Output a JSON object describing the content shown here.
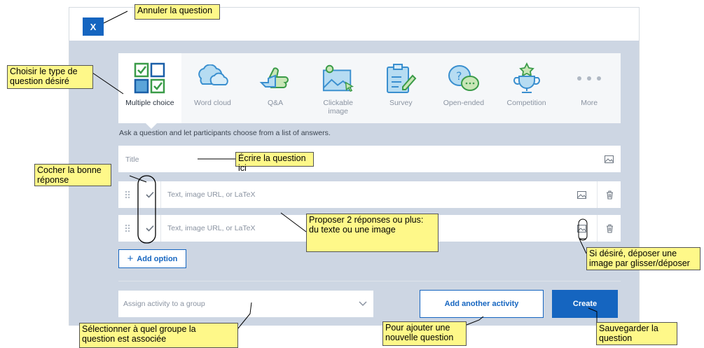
{
  "dialog": {
    "close_label": "X"
  },
  "question_types": [
    {
      "label": "Multiple choice",
      "icon": "multiple-choice-icon",
      "selected": true
    },
    {
      "label": "Word cloud",
      "icon": "word-cloud-icon"
    },
    {
      "label": "Q&A",
      "icon": "qa-icon"
    },
    {
      "label": "Clickable\nimage",
      "icon": "clickable-image-icon"
    },
    {
      "label": "Survey",
      "icon": "survey-icon"
    },
    {
      "label": "Open-ended",
      "icon": "open-ended-icon"
    },
    {
      "label": "Competition",
      "icon": "competition-icon"
    },
    {
      "label": "More",
      "icon": "more-icon"
    }
  ],
  "hint": "Ask a question and let participants choose from a list of answers.",
  "title_field": {
    "placeholder": "Title"
  },
  "options": [
    {
      "placeholder": "Text, image URL, or LaTeX",
      "checked": true
    },
    {
      "placeholder": "Text, image URL, or LaTeX",
      "checked": true
    }
  ],
  "add_option_label": "Add option",
  "group_select": {
    "placeholder": "Assign activity to a group"
  },
  "buttons": {
    "add_another": "Add another activity",
    "create": "Create"
  },
  "callouts": {
    "cancel": "Annuler la question",
    "type": "Choisir le type de\nquestion désiré",
    "write": "Écrire la question ici",
    "correct": "Cocher la bonne\nréponse",
    "answers": "Proposer 2 réponses ou plus:\ndu texte ou une image",
    "image": "Si désiré, déposer une\nimage par glisser/déposer",
    "group": "Sélectionner à quel groupe la\nquestion est associée",
    "another": "Pour ajouter une\nnouvelle question",
    "save": "Sauvegarder la\nquestion"
  },
  "colors": {
    "accent": "#1565c0",
    "panel": "#cdd6e3",
    "icon_blue": "#5ba4d9",
    "icon_green": "#3a9b48",
    "callout": "#fef889"
  }
}
